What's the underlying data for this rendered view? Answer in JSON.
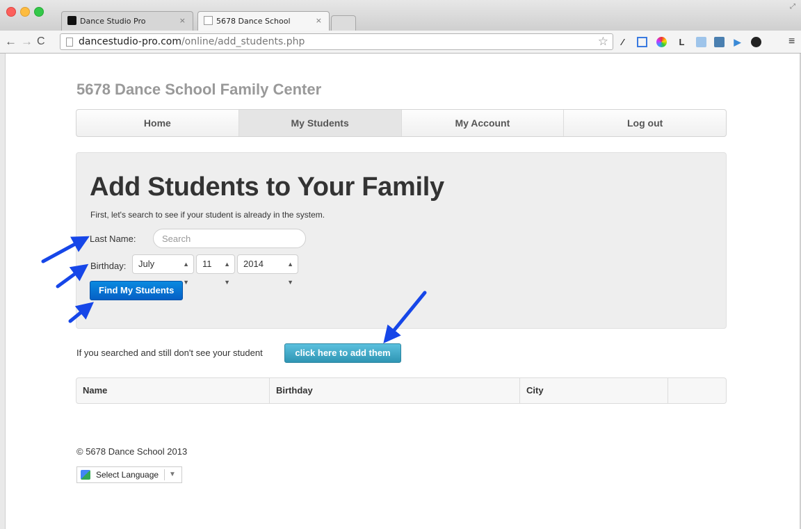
{
  "browser": {
    "tabs": [
      {
        "title": "Dance Studio Pro",
        "close": "×"
      },
      {
        "title": "5678 Dance School",
        "close": "×"
      }
    ],
    "url_host": "dancestudio-pro.com",
    "url_path": "/online/add_students.php",
    "extension_letter": "L"
  },
  "site": {
    "title": "5678 Dance School Family Center"
  },
  "nav": {
    "items": [
      "Home",
      "My Students",
      "My Account",
      "Log out"
    ],
    "active": "My Students"
  },
  "hero": {
    "heading": "Add Students to Your Family",
    "intro": "First, let's search to see if your student is already in the system.",
    "last_name_label": "Last Name:",
    "search_placeholder": "Search",
    "birthday_label": "Birthday:",
    "month": "July",
    "day": "11",
    "year": "2014",
    "find_button": "Find My Students"
  },
  "add": {
    "prompt": "If you searched and still don't see your student",
    "button": "click here to add them"
  },
  "table": {
    "headers": [
      "Name",
      "Birthday",
      "City",
      ""
    ]
  },
  "footer": {
    "copyright": "© 5678 Dance School 2013",
    "language": "Select Language"
  },
  "colors": {
    "primary_button": "#0a76d8",
    "info_button": "#49afcd",
    "annotation_arrow": "#1646e8"
  }
}
